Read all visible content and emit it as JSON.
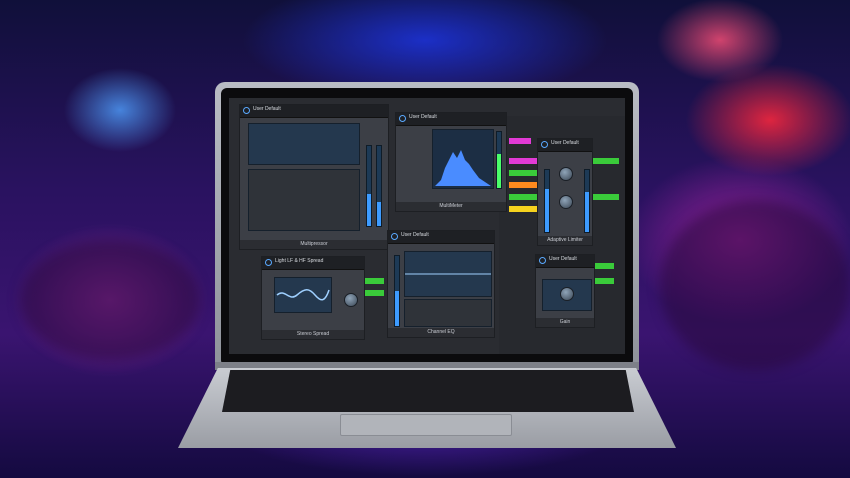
{
  "scene": {
    "description_colors": {
      "green_wave": "#6cff3a",
      "blue_wave": "#3a6bff",
      "red_light": "#ff2a40",
      "magenta": "#d43ad0"
    }
  },
  "plugins": {
    "multipressor": {
      "preset": "User Default",
      "name": "Multipressor"
    },
    "multimeter": {
      "preset": "User Default",
      "name": "MultiMeter"
    },
    "adaptive_limiter": {
      "preset": "User Default",
      "name": "Adaptive Limiter"
    },
    "stereo_spread": {
      "preset": "Light LF & HF Spread",
      "name": "Stereo Spread"
    },
    "channel_eq": {
      "preset": "User Default",
      "name": "Channel EQ"
    },
    "gain": {
      "preset": "User Default",
      "name": "Gain"
    }
  },
  "track_colors": [
    "#e23ad6",
    "#3acb3a",
    "#ff8a1e",
    "#f5d21e",
    "#3aa0ff",
    "#e84040"
  ]
}
